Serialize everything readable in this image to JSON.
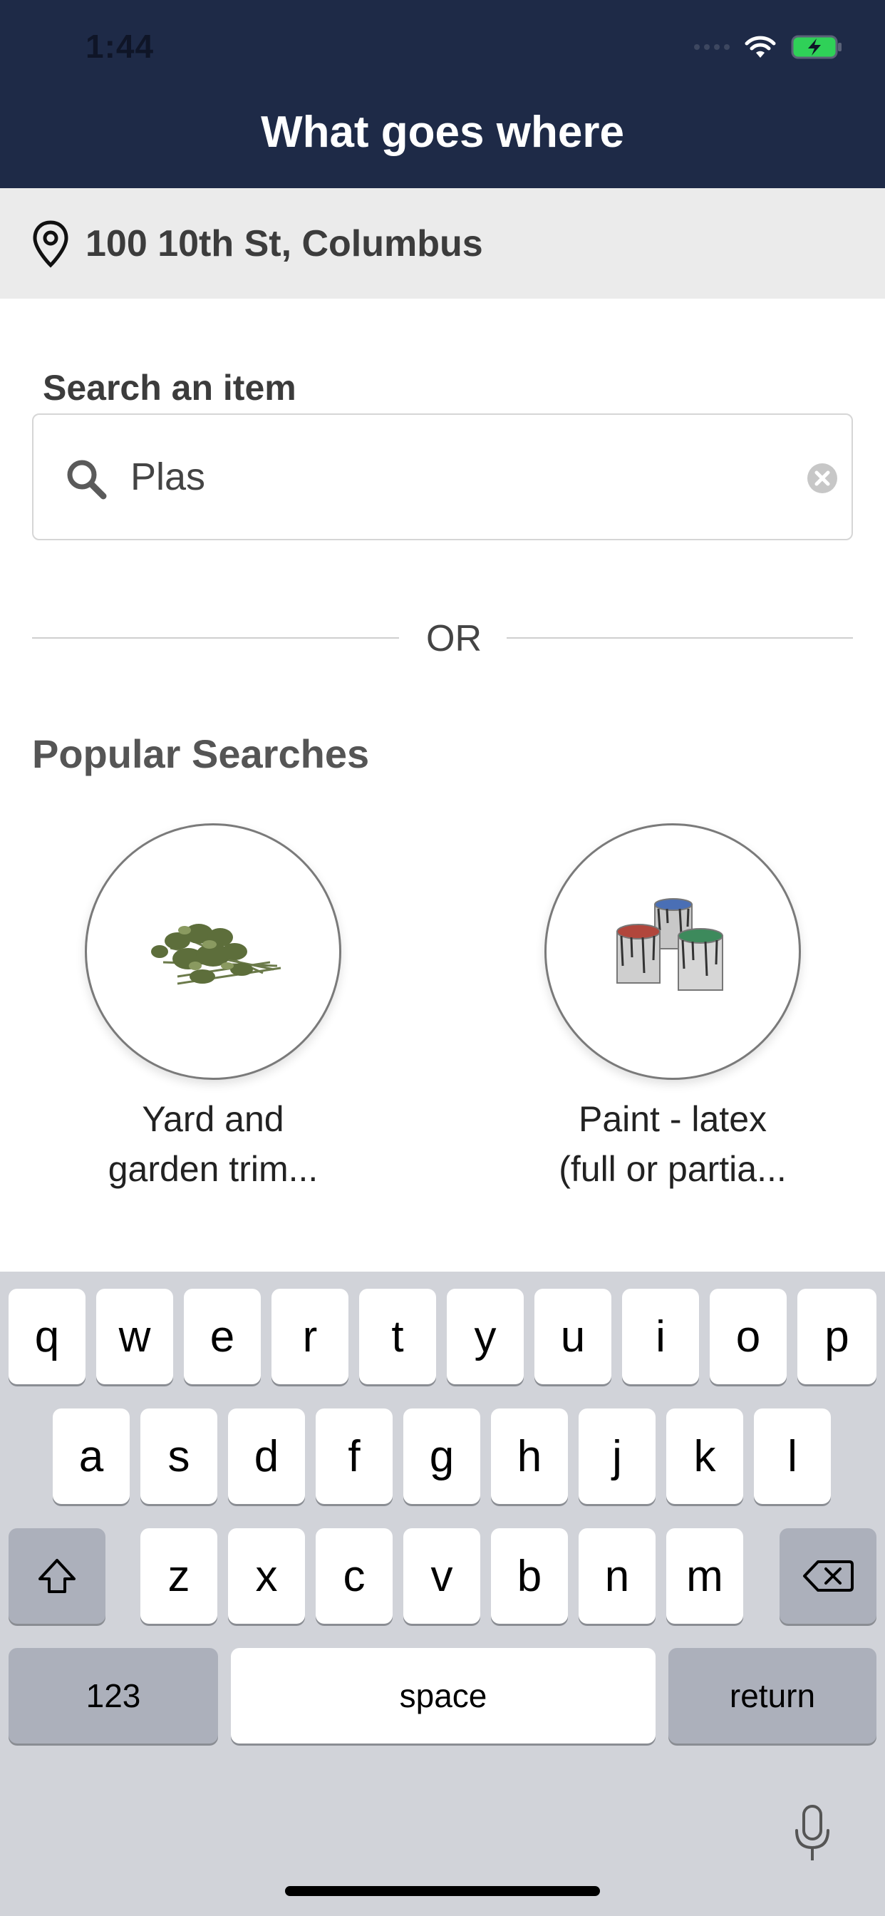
{
  "status_bar": {
    "time": "1:44"
  },
  "header": {
    "title": "What goes where",
    "background_color": "#1e2a47"
  },
  "location": {
    "icon": "location-pin-icon",
    "address": "100 10th St, Columbus"
  },
  "search": {
    "label": "Search an item",
    "value": "Plas",
    "search_icon": "search-icon",
    "clear_icon": "clear-icon"
  },
  "divider": {
    "text": "OR"
  },
  "popular": {
    "title": "Popular Searches",
    "items": [
      {
        "line1": "Yard and",
        "line2": "garden trim...",
        "icon": "yard-trimmings-image"
      },
      {
        "line1": "Paint - latex",
        "line2": "(full or partia...",
        "icon": "paint-cans-image"
      }
    ]
  },
  "keyboard": {
    "row1": [
      "q",
      "w",
      "e",
      "r",
      "t",
      "y",
      "u",
      "i",
      "o",
      "p"
    ],
    "row2": [
      "a",
      "s",
      "d",
      "f",
      "g",
      "h",
      "j",
      "k",
      "l"
    ],
    "row3": [
      "z",
      "x",
      "c",
      "v",
      "b",
      "n",
      "m"
    ],
    "numbers_label": "123",
    "space_label": "space",
    "return_label": "return",
    "shift_icon": "shift-icon",
    "delete_icon": "backspace-icon",
    "mic_icon": "microphone-icon"
  }
}
